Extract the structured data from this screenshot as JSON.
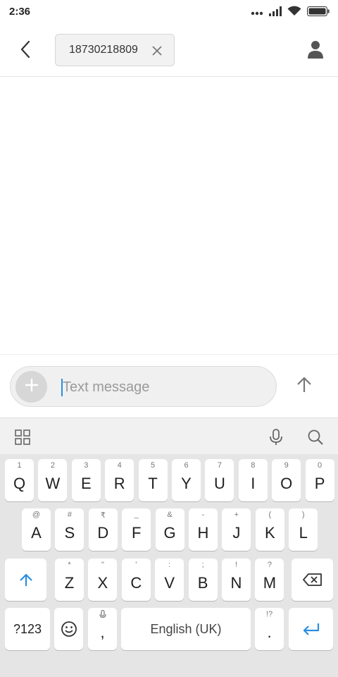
{
  "status_bar": {
    "time": "2:36",
    "icons": [
      "more-dots-icon",
      "signal-icon",
      "wifi-icon",
      "battery-icon"
    ]
  },
  "header": {
    "back_icon": "chevron-left-icon",
    "recipient": "18730218809",
    "remove_icon": "close-icon",
    "contact_icon": "person-icon"
  },
  "compose": {
    "placeholder": "Text message",
    "value": "",
    "attach_icon": "plus-icon",
    "send_icon": "arrow-up-icon"
  },
  "keyboard": {
    "toolbar": [
      "grid-icon",
      "microphone-icon",
      "search-icon"
    ],
    "row1": [
      {
        "k": "Q",
        "h": "1"
      },
      {
        "k": "W",
        "h": "2"
      },
      {
        "k": "E",
        "h": "3"
      },
      {
        "k": "R",
        "h": "4"
      },
      {
        "k": "T",
        "h": "5"
      },
      {
        "k": "Y",
        "h": "6"
      },
      {
        "k": "U",
        "h": "7"
      },
      {
        "k": "I",
        "h": "8"
      },
      {
        "k": "O",
        "h": "9"
      },
      {
        "k": "P",
        "h": "0"
      }
    ],
    "row2": [
      {
        "k": "A",
        "h": "@"
      },
      {
        "k": "S",
        "h": "#"
      },
      {
        "k": "D",
        "h": "₹"
      },
      {
        "k": "F",
        "h": "_"
      },
      {
        "k": "G",
        "h": "&"
      },
      {
        "k": "H",
        "h": "-"
      },
      {
        "k": "J",
        "h": "+"
      },
      {
        "k": "K",
        "h": "("
      },
      {
        "k": "L",
        "h": ")"
      }
    ],
    "row3": [
      {
        "k": "Z",
        "h": "*"
      },
      {
        "k": "X",
        "h": "\""
      },
      {
        "k": "C",
        "h": "'"
      },
      {
        "k": "V",
        "h": ":"
      },
      {
        "k": "B",
        "h": ";"
      },
      {
        "k": "N",
        "h": "!"
      },
      {
        "k": "M",
        "h": "?"
      }
    ],
    "symbols_label": "?123",
    "comma_label": ",",
    "space_label": "English (UK)",
    "period_label": ".",
    "period_hint": "!?",
    "shift_icon": "shift-arrow-icon",
    "backspace_icon": "backspace-icon",
    "emoji_icon": "emoji-icon",
    "enter_icon": "enter-icon",
    "accent_color": "#2a8ee0"
  }
}
